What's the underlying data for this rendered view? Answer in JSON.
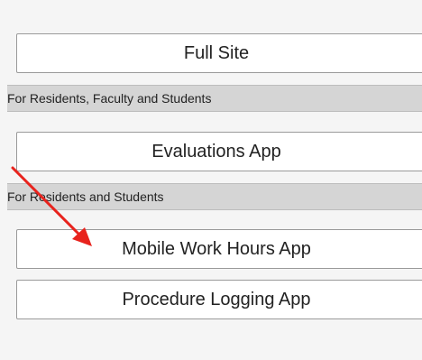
{
  "buttons": {
    "full_site": "Full Site",
    "evaluations_app": "Evaluations App",
    "mobile_work_hours_app": "Mobile Work Hours App",
    "procedure_logging_app": "Procedure Logging App"
  },
  "sections": {
    "residents_faculty_students": "For Residents, Faculty and Students",
    "residents_students": "For Residents and Students"
  },
  "annotation": {
    "arrow_color": "#e8231d",
    "arrow_target": "Mobile Work Hours App"
  }
}
